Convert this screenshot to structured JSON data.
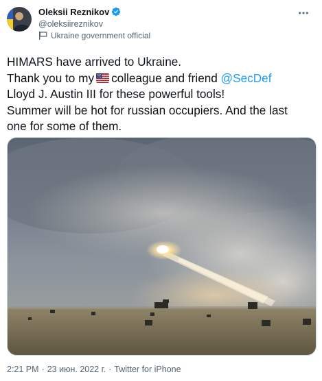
{
  "author": {
    "display_name": "Oleksii Reznikov",
    "handle": "@oleksiireznikov",
    "label": "Ukraine government official",
    "verified": true
  },
  "tweet": {
    "lines": {
      "l1": "HIMARS have arrived to Ukraine.",
      "l2_pre": "Thank you to my",
      "l2_mid": "colleague and friend",
      "l2_mention": "@SecDef",
      "l3": "Lloyd J. Austin III for these powerful tools!",
      "l4": "Summer will be hot for russian occupiers. And the last",
      "l5": "one for some of them."
    }
  },
  "meta": {
    "time": "2:21 PM",
    "date": "23 июн. 2022 г.",
    "separator": "·",
    "source": "Twitter for iPhone"
  },
  "icons": {
    "verified": "verified-badge-icon",
    "government_label": "government-flag-icon",
    "more": "more-horizontal-icon",
    "emoji_flag": "us-flag-emoji"
  },
  "colors": {
    "accent": "#1d9bf0",
    "text": "#0f1419",
    "secondary": "#536471"
  }
}
